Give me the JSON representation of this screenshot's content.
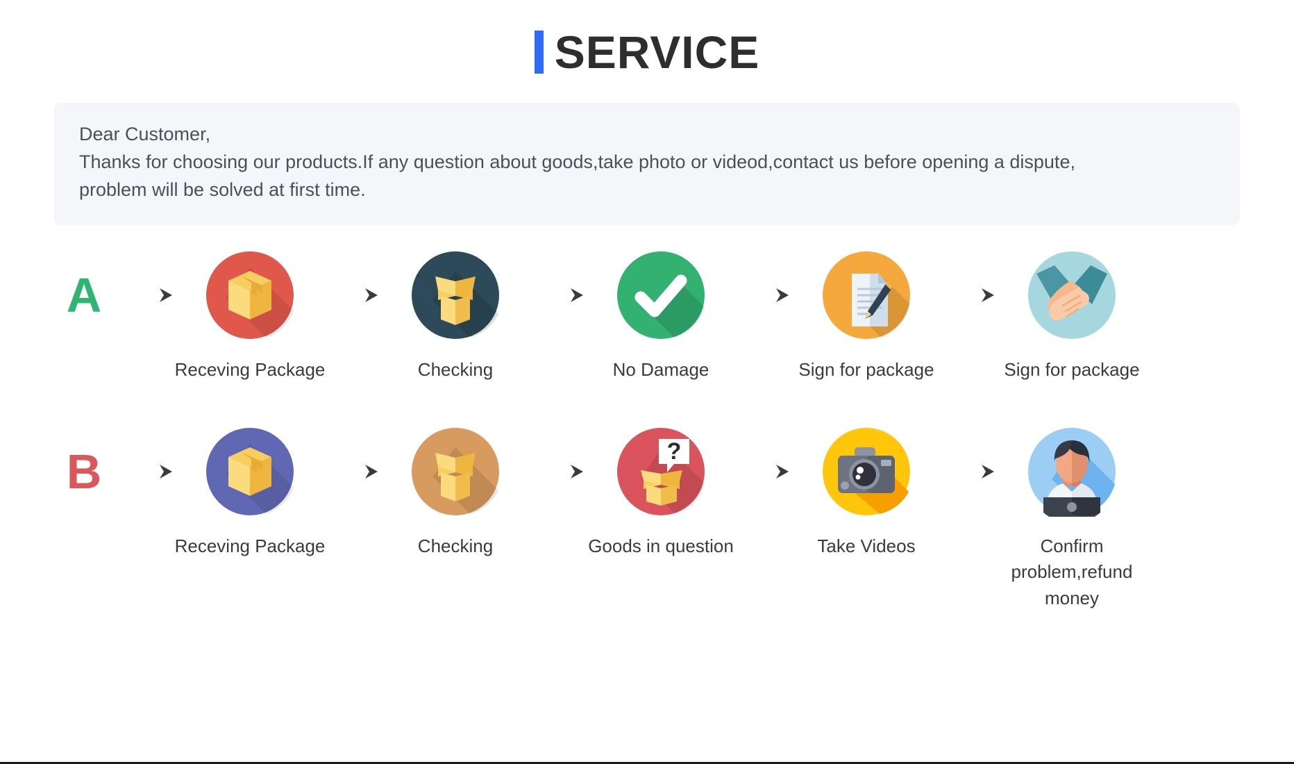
{
  "header": {
    "title": "SERVICE",
    "accent_color": "#2f6bf5",
    "title_color": "#2e2e2e"
  },
  "notice": {
    "background_color": "#f4f6fa",
    "lines": [
      "Dear Customer,",
      "Thanks for choosing our products.If any question about goods,take photo or videod,contact us before opening a dispute,",
      "problem will be solved at first time."
    ]
  },
  "flows": [
    {
      "letter": "A",
      "letter_color": "#2fb573",
      "steps": [
        {
          "icon": "package-box-icon",
          "label": "Receving Package",
          "circle_color": "#e0574c"
        },
        {
          "icon": "open-box-icon",
          "label": "Checking",
          "circle_color": "#2c4a5a"
        },
        {
          "icon": "check-circle-icon",
          "label": "No Damage",
          "circle_color": "#33b171"
        },
        {
          "icon": "sign-document-icon",
          "label": "Sign for package",
          "circle_color": "#f5a93c"
        },
        {
          "icon": "handshake-icon",
          "label": "Sign for package",
          "circle_color": "#a6d7de"
        }
      ]
    },
    {
      "letter": "B",
      "letter_color": "#d9585c",
      "steps": [
        {
          "icon": "package-box-icon",
          "label": "Receving Package",
          "circle_color": "#6068b3"
        },
        {
          "icon": "open-box-icon",
          "label": "Checking",
          "circle_color": "#d79a5f"
        },
        {
          "icon": "question-box-icon",
          "label": "Goods in question",
          "circle_color": "#d9545c"
        },
        {
          "icon": "camera-icon",
          "label": "Take Videos",
          "circle_color": "#ffc60b"
        },
        {
          "icon": "support-person-icon",
          "label": "Confirm problem,refund money",
          "circle_color": "#9ccdf5"
        }
      ]
    }
  ],
  "arrow": {
    "name": "arrow-right-icon",
    "color": "#3b3b3b"
  }
}
